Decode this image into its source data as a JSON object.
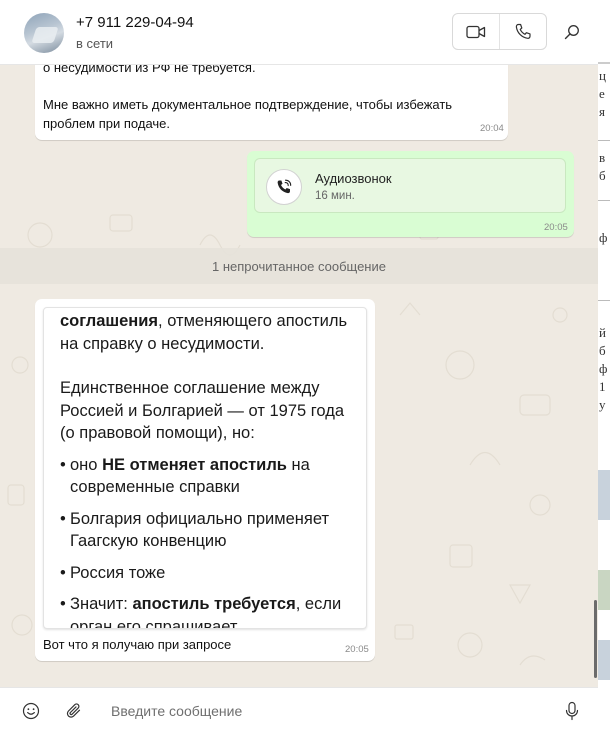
{
  "header": {
    "contact_name": "+7 911 229-04-94",
    "status": "в сети",
    "icons": [
      "video-call-icon",
      "phone-icon",
      "search-icon"
    ]
  },
  "messages": {
    "msg1": {
      "line1": "о несудимости из РФ не требуется.",
      "line2": "Мне важно иметь документальное подтверждение, чтобы избежать",
      "line3": "проблем при подаче.",
      "time": "20:04"
    },
    "call": {
      "title": "Аудиозвонок",
      "duration": "16 мин.",
      "time": "20:05"
    },
    "unread_divider": "1 непрочитанное сообщение",
    "msg3": {
      "shot": {
        "l1_bold": "соглашения",
        "l1_rest": ", отменяющего апостиль",
        "l2": "на справку о несудимости.",
        "p2_l1": "Единственное соглашение между",
        "p2_l2": "Россией и Болгарией — от 1975 года",
        "p2_l3": "(о правовой помощи), но:",
        "b1_pre": "оно ",
        "b1_bold": "НЕ отменяет апостиль",
        "b1_post": " на",
        "b1_l2": "современные справки",
        "b2_l1": "Болгария официально применяет",
        "b2_l2": "Гаагскую конвенцию",
        "b3": "Россия тоже",
        "b4_pre": "Значит: ",
        "b4_bold": "апостиль требуется",
        "b4_post": ", если",
        "b4_l2": "орган его спрашивает"
      },
      "caption": "Вот что я получаю при запросе",
      "time": "20:05"
    }
  },
  "composer": {
    "placeholder": "Введите сообщение",
    "icons": [
      "emoji-icon",
      "attach-icon",
      "microphone-icon"
    ]
  },
  "colors": {
    "chat_bg": "#efeae2",
    "outgoing_bubble": "#d9fdd3",
    "incoming_bubble": "#ffffff"
  }
}
